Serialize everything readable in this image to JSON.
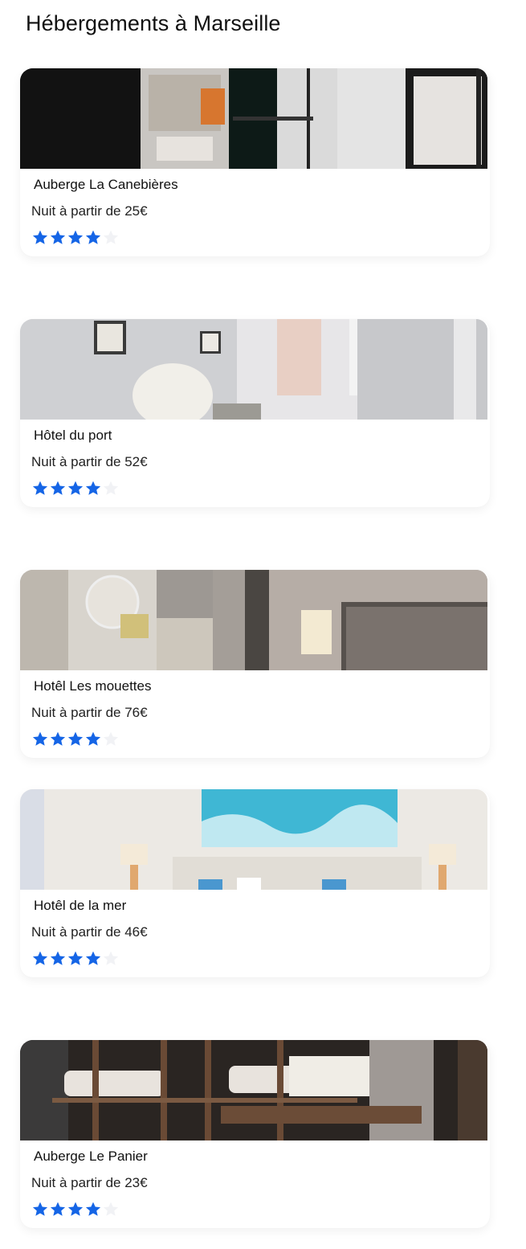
{
  "page": {
    "title": "Hébergements à Marseille"
  },
  "listings": [
    {
      "name": "Auberge La Canebières",
      "price_label": "Nuit à partir de 25€",
      "rating": 4,
      "max_rating": 5,
      "photo": "hostel-window-photo"
    },
    {
      "name": "Hôtel du port",
      "price_label": "Nuit à partir de 52€",
      "rating": 4,
      "max_rating": 5,
      "photo": "bright-room-curtain-photo"
    },
    {
      "name": "Hotêl Les mouettes",
      "price_label": "Nuit à partir de 76€",
      "rating": 4,
      "max_rating": 5,
      "photo": "room-mirror-lamp-photo"
    },
    {
      "name": "Hotêl de la mer",
      "price_label": "Nuit à partir de 46€",
      "rating": 4,
      "max_rating": 5,
      "photo": "bedroom-sea-painting-photo"
    },
    {
      "name": "Auberge Le Panier",
      "price_label": "Nuit à partir de 23€",
      "rating": 4,
      "max_rating": 5,
      "photo": "wooden-bunk-beds-photo"
    }
  ],
  "colors": {
    "star_filled": "#1565e6",
    "star_empty": "#f1f2f5"
  }
}
